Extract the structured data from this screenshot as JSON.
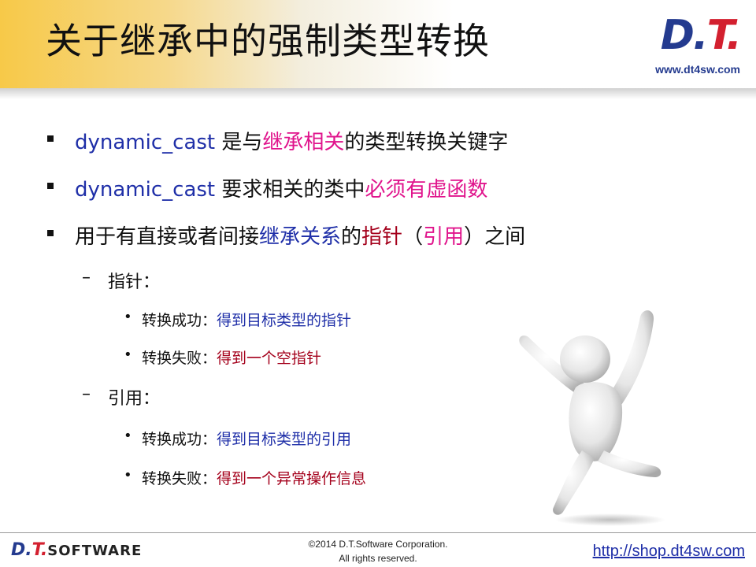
{
  "title": "关于继承中的强制类型转换",
  "logo": {
    "mark_left": "D.",
    "mark_right": "T.",
    "url": "www.dt4sw.com"
  },
  "bullets": [
    {
      "kw": "dynamic_cast",
      "a": " 是与",
      "b": "继承相关",
      "c": "的类型转换关键字"
    },
    {
      "kw": "dynamic_cast",
      "a": " 要求相关的类中",
      "b": "必须有虚函数"
    },
    {
      "a": "用于有直接或者间接",
      "b": "继承关系",
      "c": "的",
      "d": "指针",
      "e": "（",
      "f": "引用",
      "g": "）之间"
    }
  ],
  "pointer": {
    "label": "指针：",
    "success_label": "转换成功：",
    "success_value": "得到目标类型的指针",
    "fail_label": "转换失败：",
    "fail_value": "得到一个空指针"
  },
  "reference": {
    "label": "引用：",
    "success_label": "转换成功：",
    "success_value": "得到目标类型的引用",
    "fail_label": "转换失败：",
    "fail_value": "得到一个异常操作信息"
  },
  "footer": {
    "logo_left": "D.",
    "logo_right": "T.",
    "logo_text": "SOFTWARE",
    "copyright1": "©2014 D.T.Software Corporation.",
    "copyright2": "All rights reserved.",
    "url": "http://shop.dt4sw.com"
  }
}
